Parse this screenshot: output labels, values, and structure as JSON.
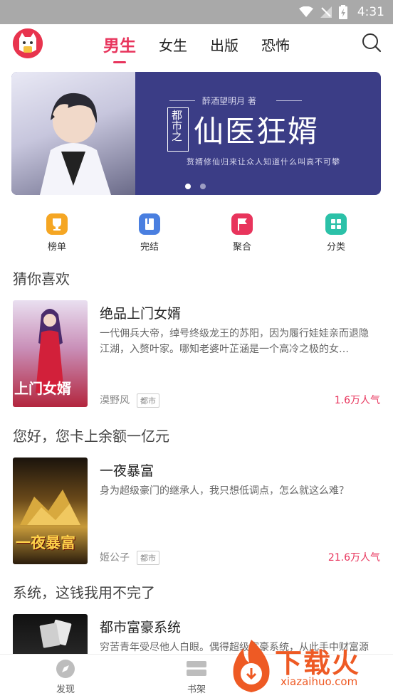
{
  "status_bar": {
    "time": "4:31"
  },
  "nav": {
    "tabs": [
      {
        "label": "男生",
        "active": true
      },
      {
        "label": "女生",
        "active": false
      },
      {
        "label": "出版",
        "active": false
      },
      {
        "label": "恐怖",
        "active": false
      }
    ]
  },
  "banner": {
    "author": "醉酒望明月 著",
    "title_prefix": "都市之",
    "title": "仙医狂婿",
    "tagline": "赘婿修仙归来让众人知道什么叫高不可攀",
    "slides": 2,
    "active_slide": 1
  },
  "quick_links": [
    {
      "label": "榜单",
      "color": "#f5a623",
      "icon": "trophy-icon"
    },
    {
      "label": "完结",
      "color": "#4a7fe0",
      "icon": "book-icon"
    },
    {
      "label": "聚合",
      "color": "#e8345c",
      "icon": "flag-icon"
    },
    {
      "label": "分类",
      "color": "#2bc1a8",
      "icon": "grid-icon"
    }
  ],
  "sections": [
    {
      "title": "猜你喜欢",
      "book": {
        "title": "绝品上门女婿",
        "desc": "一代佣兵大帝，绰号终级龙王的苏阳，因为履行娃娃亲而退隐江湖，入赘叶家。哪知老婆叶芷涵是一个高冷之极的女…",
        "author": "漠野风",
        "tag": "都市",
        "popularity": "1.6万人气",
        "cover_text": "上门女婿"
      }
    },
    {
      "title": "您好，您卡上余额一亿元",
      "book": {
        "title": "一夜暴富",
        "desc": "身为超级豪门的继承人，我只想低调点，怎么就这么难？",
        "author": "姬公子",
        "tag": "都市",
        "popularity": "21.6万人气",
        "cover_text": "一夜暴富"
      }
    },
    {
      "title": "系统，这钱我用不完了",
      "book": {
        "title": "都市富豪系统",
        "desc": "穷苦青年受尽他人白眼。偶得超级富豪系统，从此手中财富源源不断",
        "author": "",
        "tag": "",
        "popularity": "",
        "cover_text": ""
      }
    }
  ],
  "bottom_nav": [
    {
      "label": "发现",
      "icon": "compass-icon"
    },
    {
      "label": "书架",
      "icon": "bookshelf-icon"
    }
  ],
  "watermark": {
    "brand": "下载火",
    "url": "xiazaihuo.com"
  },
  "colors": {
    "accent": "#e8345c",
    "banner_bg": "#3b3d86"
  }
}
